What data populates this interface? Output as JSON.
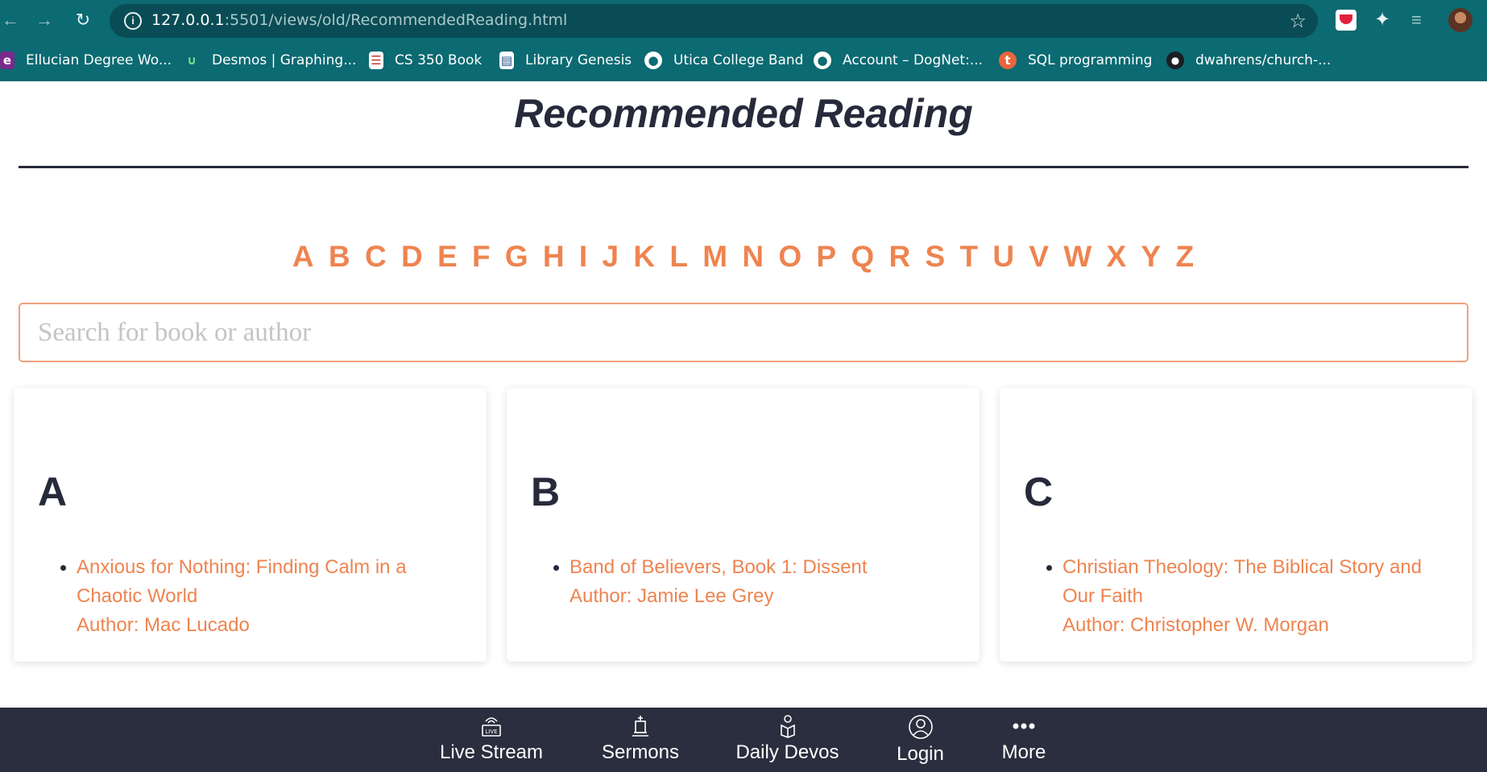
{
  "browser": {
    "url_host": "127.0.0.1",
    "url_rest": ":5501/views/old/RecommendedReading.html",
    "bookmarks": [
      {
        "label": "Ellucian Degree Wo...",
        "icon": "ellucian-icon",
        "color": "#7b2a8c"
      },
      {
        "label": "Desmos | Graphing...",
        "icon": "desmos-icon",
        "color": "#2e8b3b"
      },
      {
        "label": "CS 350 Book",
        "icon": "document-icon",
        "color": "#ffffff"
      },
      {
        "label": "Library Genesis",
        "icon": "library-icon",
        "color": "#ffffff"
      },
      {
        "label": "Utica College Band",
        "icon": "globe-icon",
        "color": "#ffffff"
      },
      {
        "label": "Account – DogNet:...",
        "icon": "globe-icon",
        "color": "#ffffff"
      },
      {
        "label": "SQL programming",
        "icon": "tutorialspoint-icon",
        "color": "#e8663d"
      },
      {
        "label": "dwahrens/church-...",
        "icon": "github-icon",
        "color": "#ffffff"
      }
    ]
  },
  "page": {
    "title": "Recommended Reading",
    "letters": [
      "A",
      "B",
      "C",
      "D",
      "E",
      "F",
      "G",
      "H",
      "I",
      "J",
      "K",
      "L",
      "M",
      "N",
      "O",
      "P",
      "Q",
      "R",
      "S",
      "T",
      "U",
      "V",
      "W",
      "X",
      "Y",
      "Z"
    ],
    "search_placeholder": "Search for book or author",
    "accent_color": "#ee8450",
    "dark_color": "#262a3a"
  },
  "cards": [
    {
      "letter": "A",
      "book": "Anxious for Nothing: Finding Calm in a Chaotic World",
      "author": "Author: Mac Lucado"
    },
    {
      "letter": "B",
      "book": "Band of Believers, Book 1: Dissent",
      "author": "Author: Jamie Lee Grey"
    },
    {
      "letter": "C",
      "book": "Christian Theology: The Biblical Story and Our Faith",
      "author": "Author: Christopher W. Morgan"
    }
  ],
  "bottom_nav": {
    "items": [
      {
        "label": "Live Stream",
        "icon": "live-stream-icon"
      },
      {
        "label": "Sermons",
        "icon": "pulpit-icon"
      },
      {
        "label": "Daily Devos",
        "icon": "reading-person-icon"
      },
      {
        "label": "Login",
        "icon": "user-circle-icon"
      },
      {
        "label": "More",
        "icon": "more-dots-icon"
      }
    ]
  }
}
